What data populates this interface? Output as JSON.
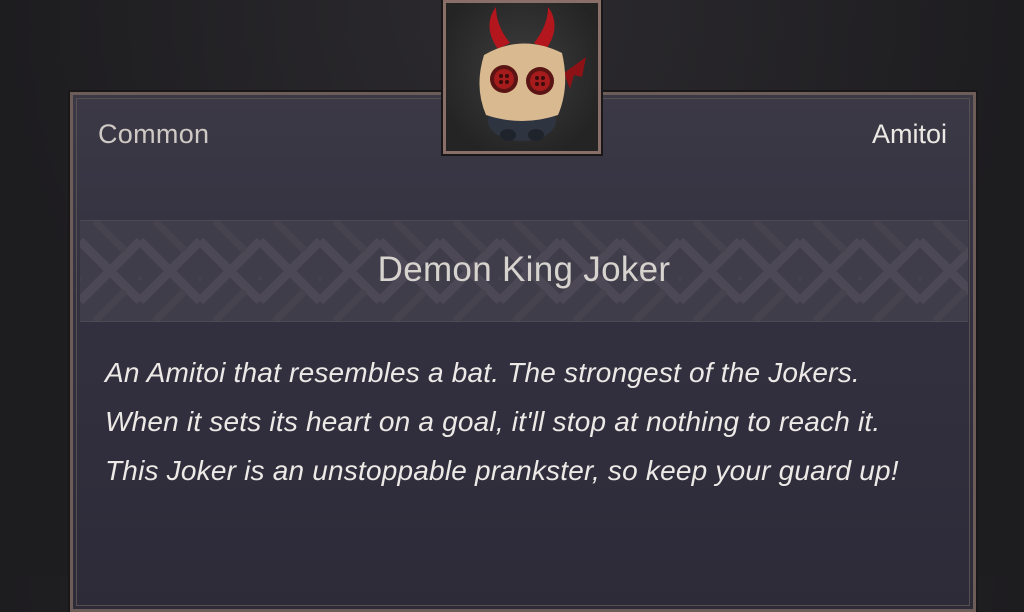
{
  "item": {
    "rarity": "Common",
    "category": "Amitoi",
    "name": "Demon King Joker",
    "description": "An Amitoi that resembles a bat. The strongest of the Jokers. When it sets its heart on a goal, it'll stop at nothing to reach it. This Joker is an unstoppable prankster, so keep your guard up!",
    "portrait_icon": "demon-king-joker-icon"
  },
  "colors": {
    "card_background": "#333140",
    "card_border": "#6d5d58",
    "banner_background": "#403d4a",
    "text_primary": "#ece9e6"
  }
}
